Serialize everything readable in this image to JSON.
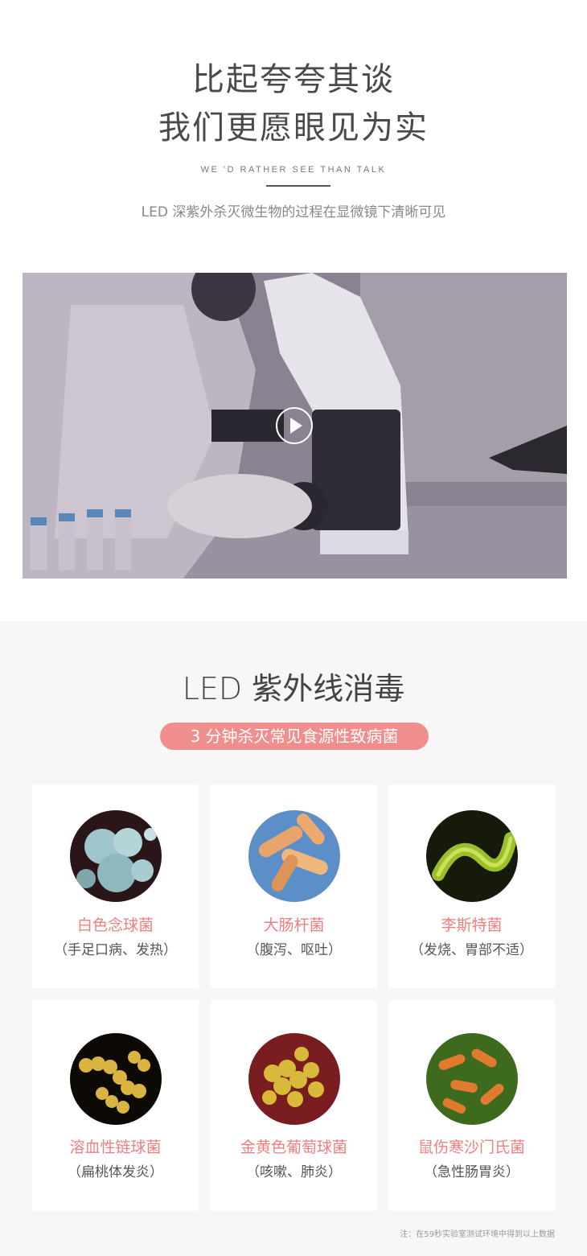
{
  "hero": {
    "headline_line1": "比起夸夸其谈",
    "headline_line2": "我们更愿眼见为实",
    "english_tagline": "WE 'D RATHER SEE THAN TALK",
    "subtitle": "LED 深紫外杀灭微生物的过程在显微镜下清晰可见"
  },
  "video": {
    "play_icon": "play-icon"
  },
  "uv_section": {
    "title": "LED 紫外线消毒",
    "badge": "3 分钟杀灭常见食源性致病菌",
    "accent_color": "#f08d8d",
    "bacteria": [
      {
        "name": "白色念球菌",
        "symptom": "（手足口病、发热）"
      },
      {
        "name": "大肠杆菌",
        "symptom": "（腹泻、呕吐）"
      },
      {
        "name": "李斯特菌",
        "symptom": "（发烧、胃部不适）"
      },
      {
        "name": "溶血性链球菌",
        "symptom": "（扁桃体发炎）"
      },
      {
        "name": "金黄色葡萄球菌",
        "symptom": "（咳嗽、肺炎）"
      },
      {
        "name": "鼠伤寒沙门氏菌",
        "symptom": "（急性肠胃炎）"
      }
    ],
    "footnote": "注：在59秒实验室测试环境中得到以上数据"
  }
}
